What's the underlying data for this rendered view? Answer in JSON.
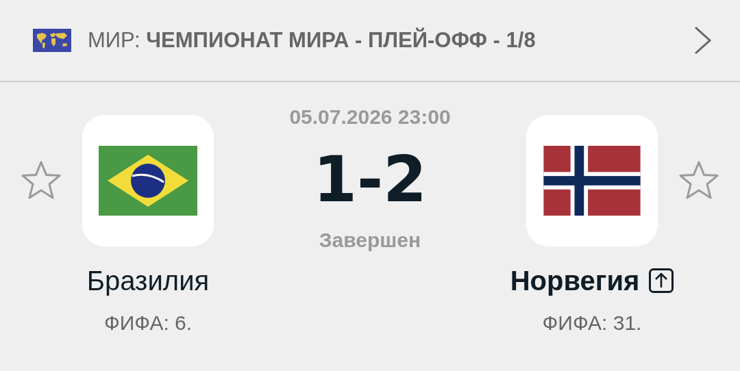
{
  "header": {
    "title": "МИР: **ЧЕМПИОНАТ МИРА - ПЛЕЙ-ОФФ - 1/8**"
  },
  "match": {
    "datetime": "05.07.2026 23:00",
    "score": "1-2",
    "status": "Завершен"
  },
  "teams": [
    {
      "name": "Бразилия",
      "rank": "ФИФА: 6.",
      "kind": "brazil",
      "winner": false,
      "advanced": false,
      "favorite": false
    },
    {
      "name": "Норвегия",
      "rank": "ФИФА: 31.",
      "kind": "norway",
      "winner": true,
      "advanced": true,
      "favorite": false
    }
  ]
}
